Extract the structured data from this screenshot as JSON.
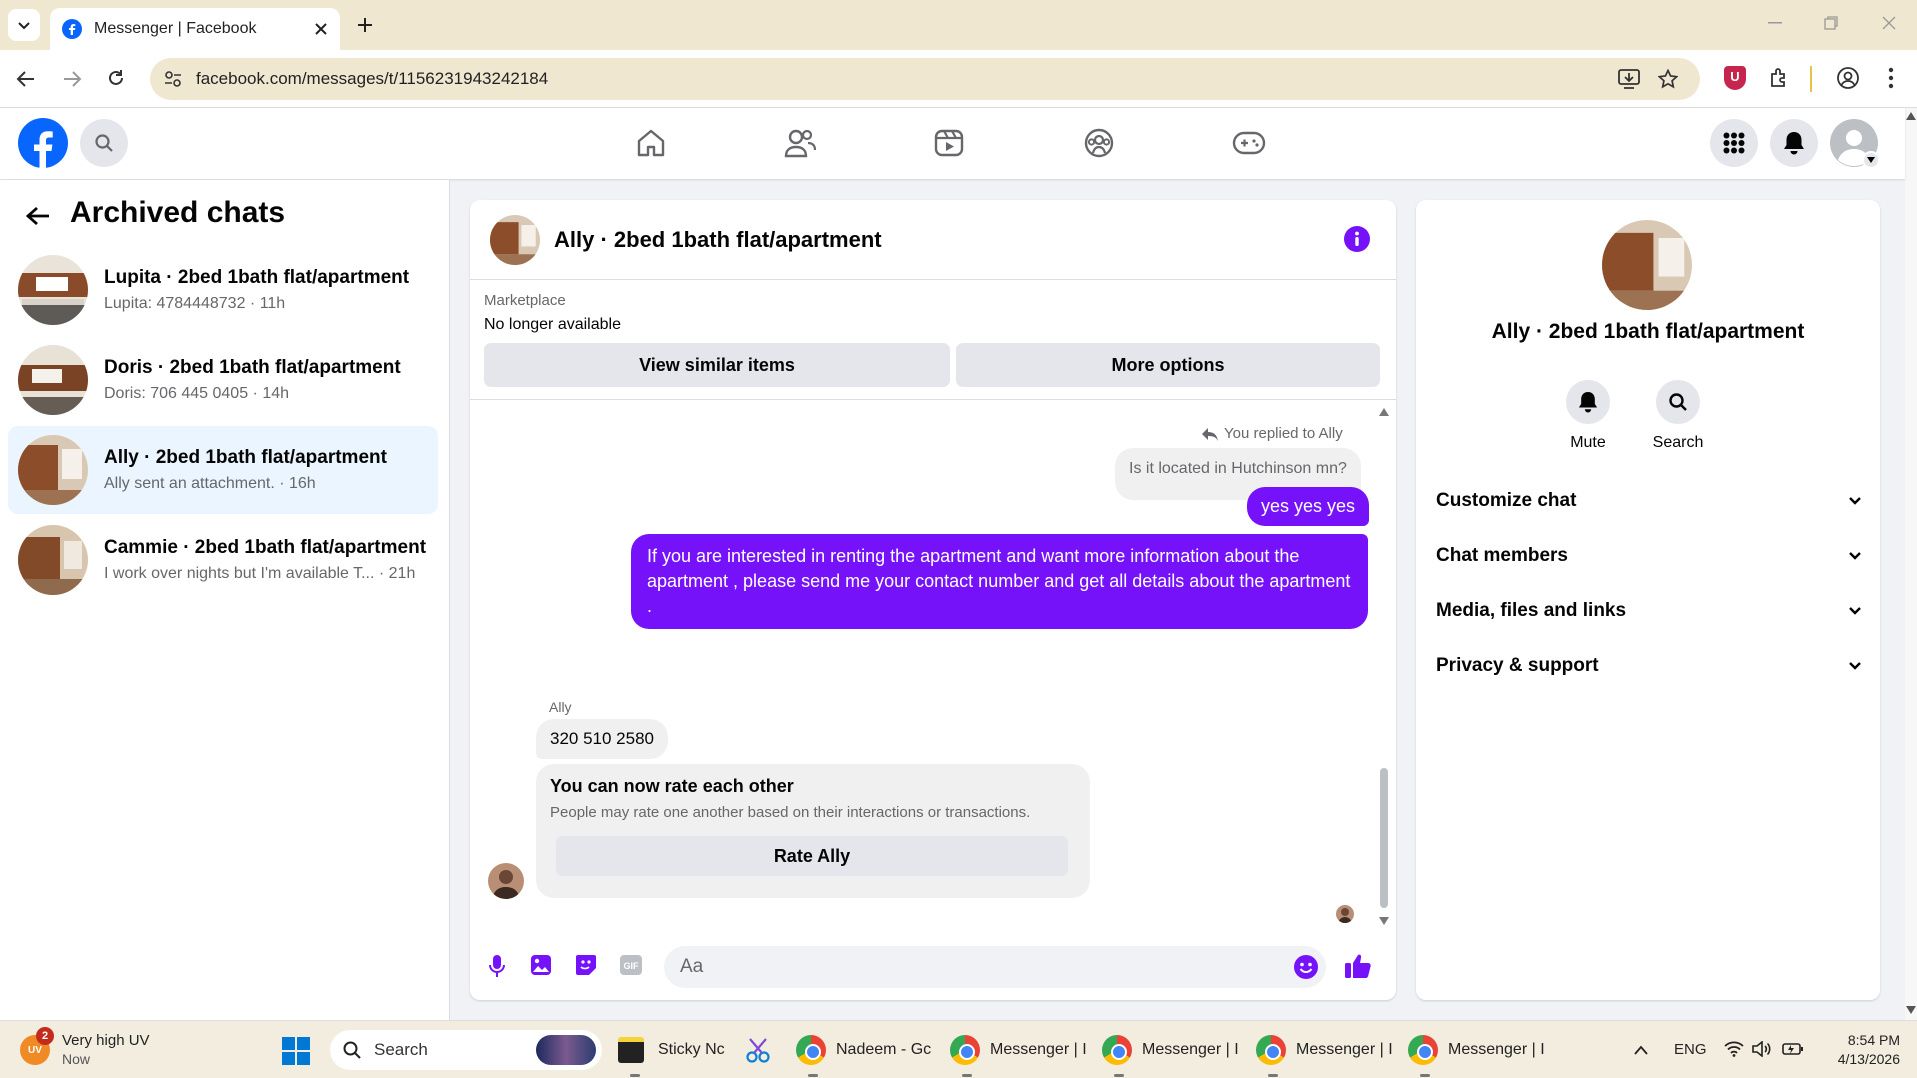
{
  "browser": {
    "tab_title": "Messenger | Facebook",
    "url": "facebook.com/messages/t/1156231943242184"
  },
  "left_panel": {
    "title": "Archived chats",
    "chats": [
      {
        "name": "Lupita · 2bed 1bath flat/apartment",
        "preview": "Lupita: 4784448732 · 11h"
      },
      {
        "name": "Doris · 2bed 1bath flat/apartment",
        "preview": "Doris: 706 445 0405 · 14h"
      },
      {
        "name": "Ally · 2bed 1bath flat/apartment",
        "preview": "Ally sent an attachment. · 16h"
      },
      {
        "name": "Cammie · 2bed 1bath flat/apartment",
        "preview": "I work over nights but I'm available T... · 21h"
      }
    ]
  },
  "conversation": {
    "title": "Ally · 2bed 1bath flat/apartment",
    "marketplace_label": "Marketplace",
    "listing_status": "No longer available",
    "view_similar_label": "View similar items",
    "more_options_label": "More options",
    "reply_indicator": "You replied to Ally",
    "quoted_message": "Is it located in Hutchinson mn?",
    "sent_message_1": "yes yes yes",
    "sent_message_2": "If you are interested in renting the apartment and want more information about the apartment , please send me your contact number and get all details about the apartment .",
    "sender_name": "Ally",
    "received_message": "320 510 2580",
    "rating_title": "You can now rate each other",
    "rating_desc": "People may rate one another based on their interactions or transactions.",
    "rate_button_label": "Rate Ally",
    "composer_placeholder": "Aa",
    "accent_color": "#7612fa"
  },
  "right_panel": {
    "name": "Ally · 2bed 1bath flat/apartment",
    "mute_label": "Mute",
    "search_label": "Search",
    "sections": [
      "Customize chat",
      "Chat members",
      "Media, files and links",
      "Privacy & support"
    ]
  },
  "taskbar": {
    "weather_title": "Very high UV",
    "weather_sub": "Now",
    "weather_badge": "2",
    "search_label": "Search",
    "apps": [
      "Sticky Nc",
      "Nadeem - Gc",
      "Messenger | I",
      "Messenger | I",
      "Messenger | I",
      "Messenger | I"
    ],
    "language": "ENG",
    "time": "8:54 PM",
    "date": "4/13/2026"
  }
}
